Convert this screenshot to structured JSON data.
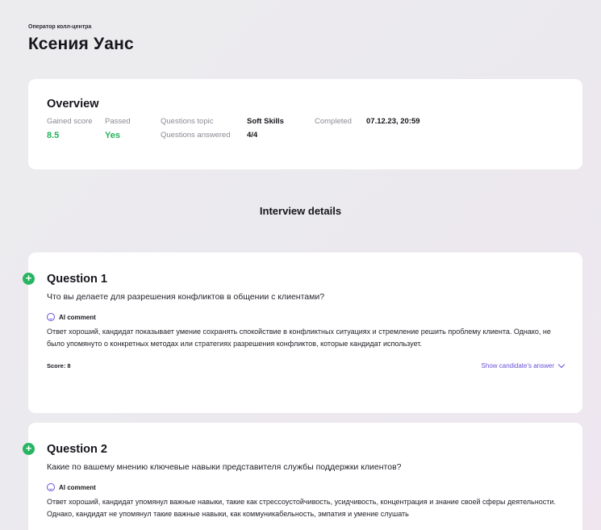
{
  "header": {
    "role": "Оператор колл-центра",
    "name": "Ксения Уанс"
  },
  "overview": {
    "title": "Overview",
    "gained_score_label": "Gained score",
    "gained_score": "8.5",
    "passed_label": "Passed",
    "passed": "Yes",
    "topic_label": "Questions topic",
    "topic": "Soft Skills",
    "answered_label": "Questions answered",
    "answered": "4/4",
    "completed_label": "Completed",
    "completed": "07.12.23, 20:59"
  },
  "interview_title": "Interview details",
  "colors": {
    "accent": "#6a4fd8",
    "green": "#22b35a"
  },
  "questions": [
    {
      "title": "Question 1",
      "text": "Что вы делаете для разрешения конфликтов в общении с клиентами?",
      "ai_label": "AI comment",
      "comment": "Ответ хороший, кандидат показывает умение сохранять спокойствие в конфликтных ситуациях и стремление решить проблему клиента. Однако, не было упомянуто о конкретных методах или стратегиях разрешения конфликтов, которые кандидат использует.",
      "score": "Score: 8",
      "show_label": "Show candidate's answer"
    },
    {
      "title": "Question 2",
      "text": "Какие по вашему мнению ключевые навыки представителя службы поддержки клиентов?",
      "ai_label": "AI comment",
      "comment": "Ответ хороший, кандидат упомянул важные навыки, такие как стрессоустойчивость, усидчивость, концентрация и знание своей сферы деятельности. Однако, кандидат не упомянул такие важные навыки, как коммуникабельность, эмпатия и умение слушать"
    }
  ]
}
